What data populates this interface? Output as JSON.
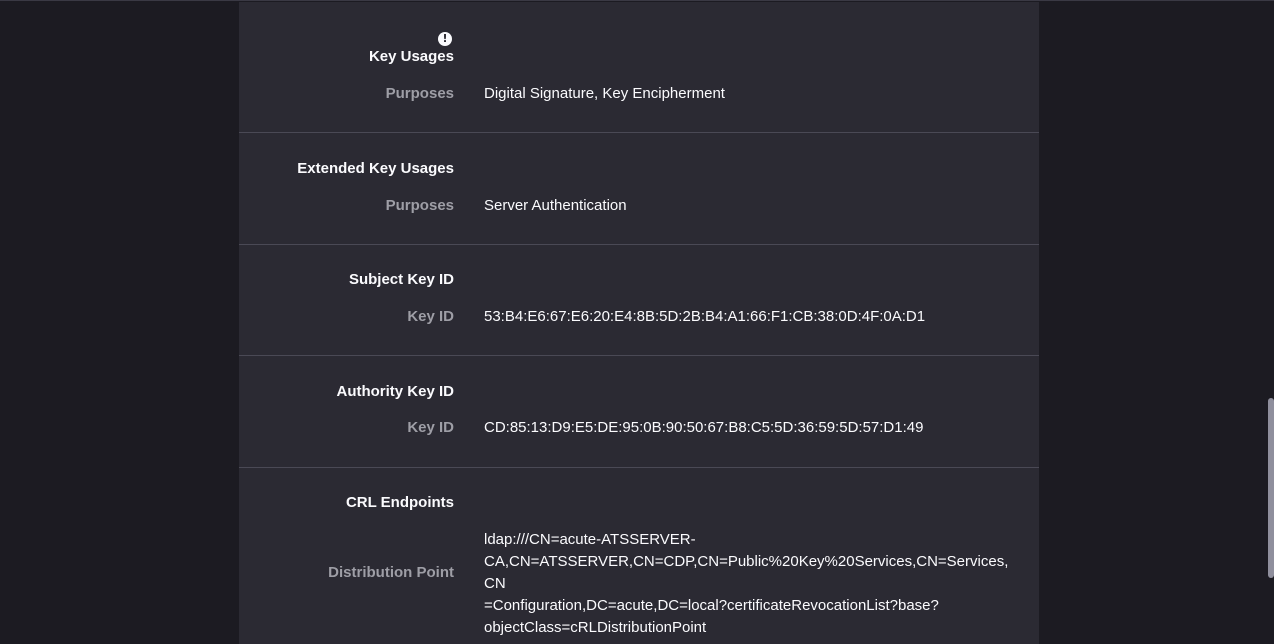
{
  "sections": [
    {
      "title": "Key Usages",
      "has_warning": true,
      "rows": [
        {
          "label": "Purposes",
          "value": "Digital Signature, Key Encipherment"
        }
      ]
    },
    {
      "title": "Extended Key Usages",
      "rows": [
        {
          "label": "Purposes",
          "value": "Server Authentication"
        }
      ]
    },
    {
      "title": "Subject Key ID",
      "rows": [
        {
          "label": "Key ID",
          "value": "53:B4:E6:67:E6:20:E4:8B:5D:2B:B4:A1:66:F1:CB:38:0D:4F:0A:D1"
        }
      ]
    },
    {
      "title": "Authority Key ID",
      "rows": [
        {
          "label": "Key ID",
          "value": "CD:85:13:D9:E5:DE:95:0B:90:50:67:B8:C5:5D:36:59:5D:57:D1:49"
        }
      ]
    },
    {
      "title": "CRL Endpoints",
      "rows": [
        {
          "label": "Distribution Point",
          "value_lines": [
            "ldap:///CN=acute-ATSSERVER-",
            "CA,CN=ATSSERVER,CN=CDP,CN=Public%20Key%20Services,CN=Services,CN",
            "=Configuration,DC=acute,DC=local?certificateRevocationList?base?",
            "objectClass=cRLDistributionPoint"
          ]
        }
      ]
    }
  ],
  "warning_icon": {
    "name": "warning-icon",
    "glyph": "!"
  }
}
